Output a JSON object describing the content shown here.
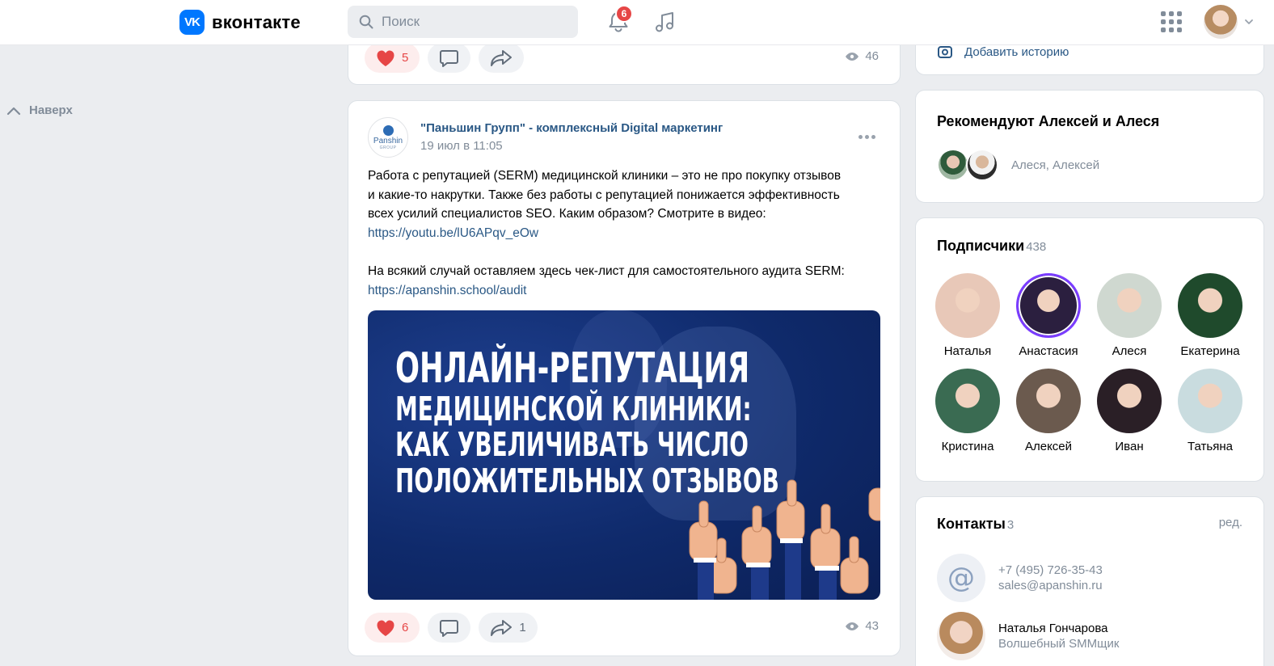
{
  "header": {
    "logo_mark": "VK",
    "logo_text": "вконтакте",
    "search_placeholder": "Поиск",
    "notifications_count": "6"
  },
  "sidebar": {
    "scroll_up_label": "Наверх"
  },
  "prev_post": {
    "likes": "5",
    "views": "46"
  },
  "post": {
    "author": "\"Паньшин Групп\" - комплексный Digital маркетинг",
    "date": "19 июл в 11:05",
    "avatar_text": "Panshin",
    "avatar_sub": "GROUP",
    "text_line1": "Работа с репутацией (SERM) медицинской клиники – это не про покупку отзывов",
    "text_line2": "и какие-то накрутки. Также без работы с репутацией понижается эффективность",
    "text_line3": "всех усилий специалистов SEO. Каким образом? Смотрите в видео:",
    "link1": "https://youtu.be/lU6APqv_eOw",
    "text_line4": "На всякий случай оставляем здесь чек-лист для самостоятельного аудита SERM:",
    "link2": "https://apanshin.school/audit",
    "image_headline": [
      "Онлайн-репутация",
      "медицинской клиники:",
      "как увеличивать число",
      "положительных отзывов"
    ],
    "likes": "6",
    "shares": "1",
    "views": "43"
  },
  "right": {
    "story_label": "Добавить историю",
    "recommend_title": "Рекомендуют Алексей и Алеся",
    "recommend_names": "Алеся, Алексей",
    "subscribers_title": "Подписчики",
    "subscribers_count": "438",
    "subscribers": [
      {
        "name": "Наталья",
        "color": "#e8c8b8"
      },
      {
        "name": "Анастасия",
        "color": "#2b1f3f"
      },
      {
        "name": "Алеся",
        "color": "#cfd8d0"
      },
      {
        "name": "Екатерина",
        "color": "#1f4a2c"
      },
      {
        "name": "Кристина",
        "color": "#3a6b52"
      },
      {
        "name": "Алексей",
        "color": "#6b5a4e"
      },
      {
        "name": "Иван",
        "color": "#2a1f26"
      },
      {
        "name": "Татьяна",
        "color": "#c9dcdf"
      }
    ],
    "contacts_title": "Контакты",
    "contacts_count": "3",
    "contacts_edit": "ред.",
    "contact_phone": "+7 (495) 726-35-43",
    "contact_email": "sales@apanshin.ru",
    "contact_person_name": "Наталья Гончарова",
    "contact_person_role": "Волшебный SMMщик"
  },
  "colors": {
    "accent": "#0077ff",
    "link": "#2a5885",
    "like": "#e64646",
    "background": "#ebedf0"
  }
}
